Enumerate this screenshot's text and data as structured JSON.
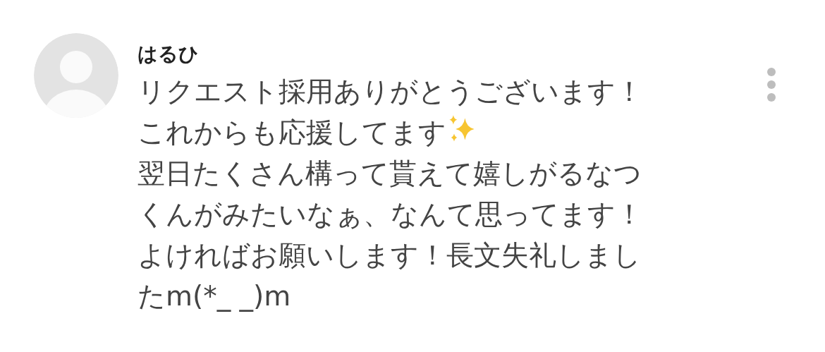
{
  "comment": {
    "author": "はるひ",
    "lines": [
      {
        "text": "リクエスト採用ありがとうございます！",
        "sparkle": false
      },
      {
        "text": "これからも応援してます",
        "sparkle": true
      },
      {
        "text": "翌日たくさん構って貰えて嬉しがるなつ",
        "sparkle": false
      },
      {
        "text": "くんがみたいなぁ、なんて思ってます！",
        "sparkle": false
      },
      {
        "text": "よければお願いします！長文失礼しまし",
        "sparkle": false
      },
      {
        "text": "たm(*_ _)m",
        "sparkle": false
      }
    ]
  }
}
